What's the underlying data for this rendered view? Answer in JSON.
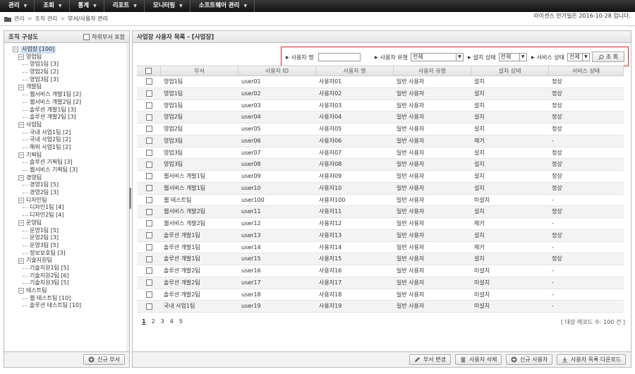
{
  "menu": [
    {
      "label": "관리"
    },
    {
      "label": "조회"
    },
    {
      "label": "통계"
    },
    {
      "label": "리포트"
    },
    {
      "label": "모니터링"
    },
    {
      "label": "소프트웨어 관리"
    }
  ],
  "breadcrumb": {
    "items": [
      "관리",
      "조직 관리",
      "부서/사용자 관리"
    ]
  },
  "license_notice": "라이센스 만기일은 2016-10-28 입니다.",
  "left_panel": {
    "title": "조직 구성도",
    "include_sub_label": "하위부서 포함",
    "add_dept_label": "신규 부서",
    "tree": [
      {
        "label": "사업장 [100]",
        "level": 0,
        "toggle": "−"
      },
      {
        "label": "영업팀",
        "level": 1,
        "toggle": "−"
      },
      {
        "label": "영업1팀 [3]",
        "level": 2
      },
      {
        "label": "영업2팀 [2]",
        "level": 2
      },
      {
        "label": "영업3팀 [3]",
        "level": 2
      },
      {
        "label": "개발팀",
        "level": 1,
        "toggle": "−"
      },
      {
        "label": "웹서비스 개발1팀 [2]",
        "level": 2
      },
      {
        "label": "웹서비스 개발2팀 [2]",
        "level": 2
      },
      {
        "label": "솔루션 개발1팀 [3]",
        "level": 2
      },
      {
        "label": "솔루션 개발2팀 [3]",
        "level": 2
      },
      {
        "label": "사업팀",
        "level": 1,
        "toggle": "−"
      },
      {
        "label": "국내 사업1팀 [2]",
        "level": 2
      },
      {
        "label": "국내 사업2팀 [2]",
        "level": 2
      },
      {
        "label": "해외 사업1팀 [2]",
        "level": 2
      },
      {
        "label": "기획팀",
        "level": 1,
        "toggle": "−"
      },
      {
        "label": "솔루션 기획팀 [3]",
        "level": 2
      },
      {
        "label": "웹서비스 기획팀 [3]",
        "level": 2
      },
      {
        "label": "경영팀",
        "level": 1,
        "toggle": "−"
      },
      {
        "label": "경영1팀 [5]",
        "level": 2
      },
      {
        "label": "경영2팀 [3]",
        "level": 2
      },
      {
        "label": "디자인팀",
        "level": 1,
        "toggle": "−"
      },
      {
        "label": "디자인1팀 [4]",
        "level": 2
      },
      {
        "label": "디자인2팀 [4]",
        "level": 2
      },
      {
        "label": "운영팀",
        "level": 1,
        "toggle": "−"
      },
      {
        "label": "운영1팀 [5]",
        "level": 2
      },
      {
        "label": "운영2팀 [3]",
        "level": 2
      },
      {
        "label": "운영3팀 [5]",
        "level": 2
      },
      {
        "label": "정보보호팀 [3]",
        "level": 2
      },
      {
        "label": "기술지원팀",
        "level": 1,
        "toggle": "−"
      },
      {
        "label": "기술지원1팀 [5]",
        "level": 2
      },
      {
        "label": "기술지원2팀 [6]",
        "level": 2
      },
      {
        "label": "기술지원3팀 [5]",
        "level": 2
      },
      {
        "label": "테스트팀",
        "level": 1,
        "toggle": "−"
      },
      {
        "label": "웹 테스트팀 [10]",
        "level": 2
      },
      {
        "label": "솔루션 테스트팀 [10]",
        "level": 2
      }
    ]
  },
  "right_panel": {
    "title": "사업장 사용자 목록 - [사업장]",
    "search": {
      "user_name_label": "사용자 명",
      "user_name_value": "",
      "user_type_label": "사용자 유형",
      "user_type_value": "전체",
      "install_status_label": "설치 상태",
      "install_status_value": "전체",
      "service_status_label": "서비스 상태",
      "service_status_value": "전체",
      "search_button": "조 회"
    },
    "columns": [
      "부서",
      "사용자 ID",
      "사용자 명",
      "사용자 유형",
      "설치 상태",
      "서비스 상태"
    ],
    "rows": [
      [
        "영업1팀",
        "user01",
        "사용자01",
        "일반 사용자",
        "설치",
        "정상"
      ],
      [
        "영업1팀",
        "user02",
        "사용자02",
        "일반 사용자",
        "설치",
        "정상"
      ],
      [
        "영업1팀",
        "user03",
        "사용자03",
        "일반 사용자",
        "설치",
        "정상"
      ],
      [
        "영업2팀",
        "user04",
        "사용자04",
        "일반 사용자",
        "설치",
        "정상"
      ],
      [
        "영업2팀",
        "user05",
        "사용자05",
        "일반 사용자",
        "설치",
        "정상"
      ],
      [
        "영업3팀",
        "user06",
        "사용자06",
        "일반 사용자",
        "제거",
        "-"
      ],
      [
        "영업3팀",
        "user07",
        "사용자07",
        "일반 사용자",
        "설치",
        "정상"
      ],
      [
        "영업3팀",
        "user08",
        "사용자08",
        "일반 사용자",
        "설치",
        "정상"
      ],
      [
        "웹서비스 개발1팀",
        "user09",
        "사용자09",
        "일반 사용자",
        "설치",
        "정상"
      ],
      [
        "웹서비스 개발1팀",
        "user10",
        "사용자10",
        "일반 사용자",
        "설치",
        "정상"
      ],
      [
        "웹 테스트팀",
        "user100",
        "사용자100",
        "일반 사용자",
        "미설치",
        "-"
      ],
      [
        "웹서비스 개발2팀",
        "user11",
        "사용자11",
        "일반 사용자",
        "설치",
        "정상"
      ],
      [
        "웹서비스 개발2팀",
        "user12",
        "사용자12",
        "일반 사용자",
        "제거",
        "-"
      ],
      [
        "솔루션 개발1팀",
        "user13",
        "사용자13",
        "일반 사용자",
        "설치",
        "정상"
      ],
      [
        "솔루션 개발1팀",
        "user14",
        "사용자14",
        "일반 사용자",
        "제거",
        "-"
      ],
      [
        "솔루션 개발1팀",
        "user15",
        "사용자15",
        "일반 사용자",
        "설치",
        "정상"
      ],
      [
        "솔루션 개발2팀",
        "user16",
        "사용자16",
        "일반 사용자",
        "미설치",
        "-"
      ],
      [
        "솔루션 개발2팀",
        "user17",
        "사용자17",
        "일반 사용자",
        "미설치",
        "-"
      ],
      [
        "솔루션 개발2팀",
        "user18",
        "사용자18",
        "일반 사용자",
        "미설치",
        "-"
      ],
      [
        "국내 사업1팀",
        "user19",
        "사용자19",
        "일반 사용자",
        "미설치",
        "-"
      ]
    ],
    "pages": [
      "1",
      "2",
      "3",
      "4",
      "5"
    ],
    "total": "[ 대상 레코드 수: 100 건 ]",
    "buttons": {
      "change_dept": "부서 변경",
      "delete_user": "사용자 삭제",
      "add_user": "신규 사용자",
      "download": "사용자 목록 다운로드"
    }
  }
}
